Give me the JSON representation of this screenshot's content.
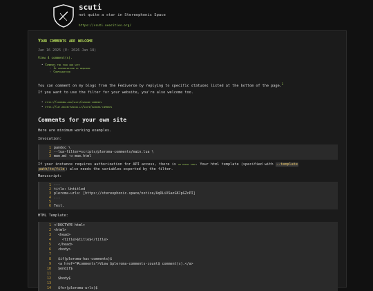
{
  "site": {
    "title": "scuti",
    "subtitle": "not quite a star in Stereophonic Space",
    "url": "https://scuti.neocities.org/"
  },
  "post": {
    "title": "Your comments are welcome",
    "date": "Jan 16 2025 (E: 2026 Jan 18)",
    "comments_link": "View 4 comment(s).",
    "toc": [
      {
        "label": "Comments for your own site",
        "level": 1
      },
      {
        "label": "If authorization is required",
        "level": 2
      },
      {
        "label": "Configuration",
        "level": 2
      }
    ],
    "intro": "You can comment on my blogs from the Fediverse by replying to specific statuses listed at the bottom of the page.",
    "footnote_mark": "1",
    "filter_note": "If you want to use the filter for your website, you're also welcome too.",
    "links": [
      "https://codeberg.org/scuti/pleroma-comments",
      "https://git.projectsegfau.lt/scuti/pleroma-comments"
    ],
    "section_heading": "Comments for your own site",
    "examples_note": "Here are minimum working examples.",
    "invocation_label": "Invocation:",
    "invocation_code": [
      "pandoc \\",
      "--lua-filter=scripts/pleroma-comments/main.lua \\",
      "mwe.md -o mwe.html"
    ],
    "auth_note_1": "If your instance requires authorization for API access, there is",
    "auth_link": "an extra step",
    "auth_note_2": ". Your html template (specified with",
    "auth_code_1": "--template",
    "auth_note_3": "",
    "auth_code_2": "path/to/file",
    "auth_note_4": ") also needs the variables exported by the filter.",
    "manuscript_label": "Manuscript:",
    "manuscript_code": [
      "---",
      "title: Untitled",
      "pleroma-urls: [https://stereophonic.space/notice/AqDLiXSazGKJpGZcPI]",
      "...",
      "",
      "Test."
    ],
    "html_template_label": "HTML Template:",
    "html_code": [
      "<!DOCTYPE html>",
      "<html>",
      "  <head>",
      "    <title>$title$</title>",
      "  </head>",
      "  <body>",
      "",
      "  $if(pleroma-has-comments)$",
      "  <a href=\"#comments\">View $pleroma-comments-count$ comment(s).</a>",
      "  $endif$",
      "",
      "  $body$",
      "",
      "  $for(pleroma-urls)$"
    ]
  },
  "colors": {
    "background": "#111111",
    "panel": "#1b1b1b",
    "accent": "#9fd05a",
    "title": "#b9e05b",
    "code_bg": "#2a2a2a",
    "line_number": "#d6a93a"
  }
}
